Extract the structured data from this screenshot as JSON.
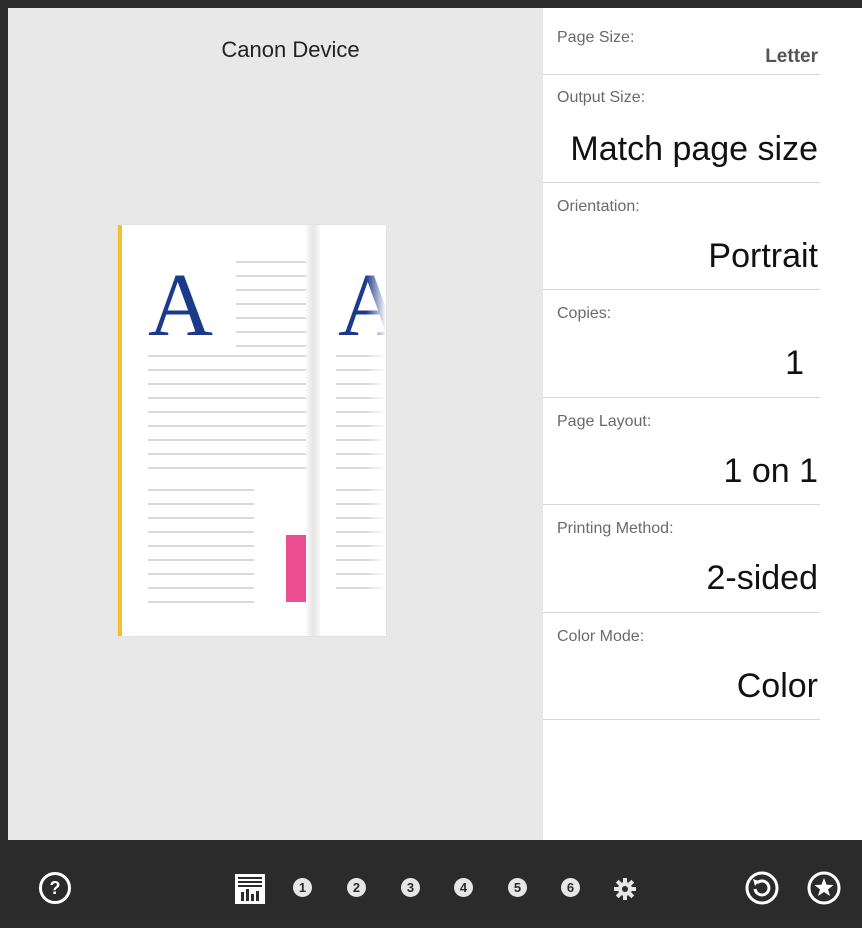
{
  "preview": {
    "device_name": "Canon Device",
    "sample_glyph": "A"
  },
  "settings": [
    {
      "label": "Page Size:",
      "value": "Letter"
    },
    {
      "label": "Output Size:",
      "value": "Match page size"
    },
    {
      "label": "Orientation:",
      "value": "Portrait"
    },
    {
      "label": "Copies:",
      "value": "1"
    },
    {
      "label": "Page Layout:",
      "value": "1 on 1"
    },
    {
      "label": "Printing Method:",
      "value": "2-sided"
    },
    {
      "label": "Color Mode:",
      "value": "Color"
    }
  ],
  "bottom_bar": {
    "help_glyph": "?",
    "tabs": [
      "1",
      "2",
      "3",
      "4",
      "5",
      "6"
    ],
    "icons": [
      "help-icon",
      "print-preview-sheet-icon",
      "gear-icon",
      "restore-defaults-icon",
      "favorite-star-icon"
    ]
  },
  "colors": {
    "bar_background": "#2b2b2b",
    "preview_background": "#e8e8e8",
    "glyph_blue": "#1c3a8c",
    "accent_yellow": "#f2c029",
    "accent_pink": "#ec4e92"
  }
}
